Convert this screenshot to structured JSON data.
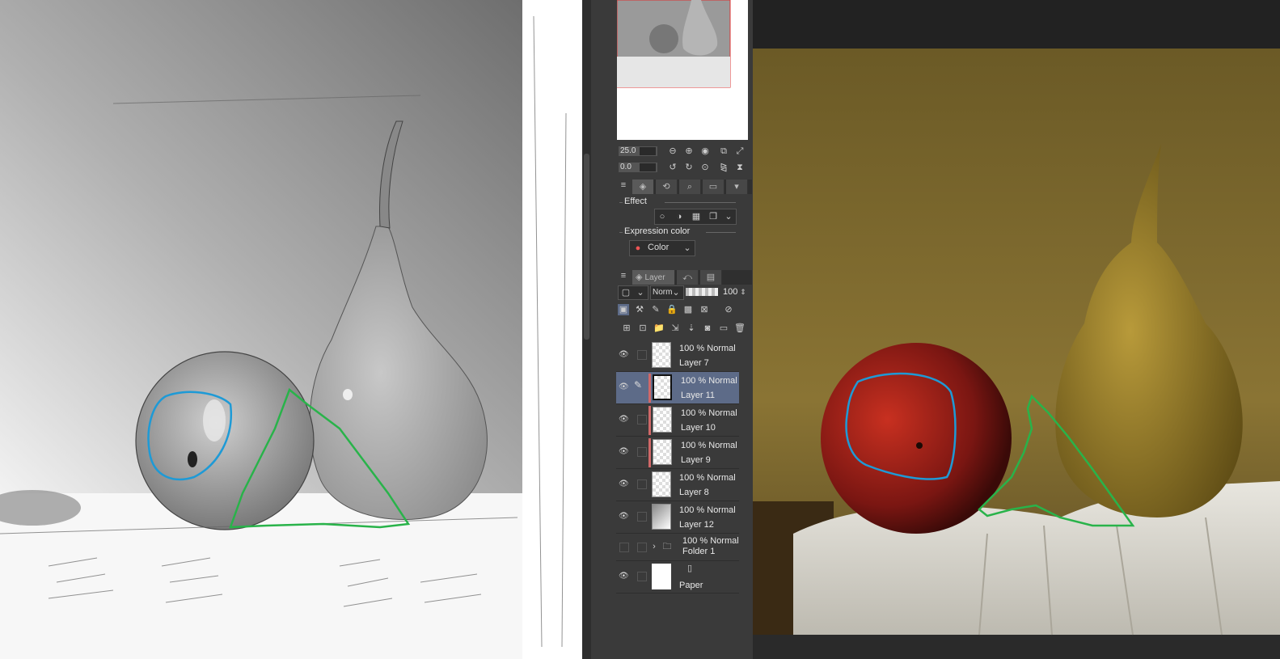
{
  "navigator": {
    "zoom_value": "25.0",
    "rotate_value": "0.0"
  },
  "layer_property": {
    "effect_label": "Effect",
    "expression_color_label": "Expression color",
    "expression_color_value": "Color"
  },
  "layer_palette": {
    "tab_label": "Layer",
    "blend_mode": "Normal",
    "opacity": "100"
  },
  "layers": [
    {
      "mode": "100 % Normal",
      "name": "Layer 7",
      "visible": true,
      "selected": false,
      "marker": false
    },
    {
      "mode": "100 % Normal",
      "name": "Layer 11",
      "visible": true,
      "selected": true,
      "marker": true
    },
    {
      "mode": "100 % Normal",
      "name": "Layer 10",
      "visible": true,
      "selected": false,
      "marker": true
    },
    {
      "mode": "100 % Normal",
      "name": "Layer 9",
      "visible": true,
      "selected": false,
      "marker": true
    },
    {
      "mode": "100 % Normal",
      "name": "Layer 8",
      "visible": true,
      "selected": false,
      "marker": false
    },
    {
      "mode": "100 % Normal",
      "name": "Layer 12",
      "visible": true,
      "selected": false,
      "marker": false
    },
    {
      "mode": "100 % Normal",
      "name": "Folder 1",
      "visible": false,
      "selected": false,
      "marker": false,
      "type": "folder"
    },
    {
      "mode": "",
      "name": "Paper",
      "visible": true,
      "selected": false,
      "marker": false,
      "type": "paper"
    }
  ],
  "colors": {
    "selection_outline_blue": "#1e9ad6",
    "selection_outline_green": "#29b34a",
    "selected_layer": "#5d6b88",
    "layer_marker": "#d06868"
  }
}
